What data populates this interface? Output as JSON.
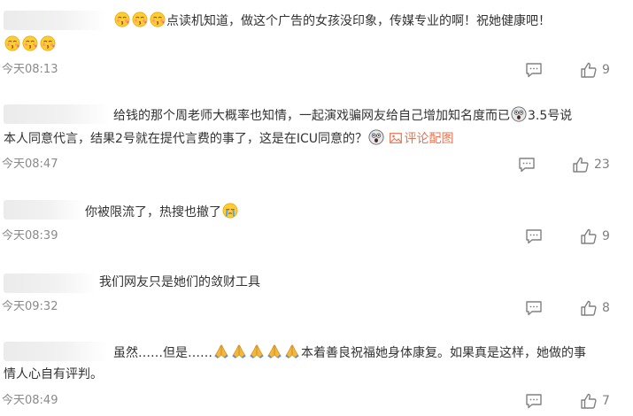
{
  "comments": [
    {
      "line1": "点读机知道，做这个广告的女孩没印象，传媒专业的啊！祝她健康吧！",
      "time": "今天08:13",
      "likes": "9"
    },
    {
      "line1a": "给钱的那个周老师大概率也知情，一起演戏骗网友给自己增加知名度而已",
      "line1b": "3.5号说",
      "line2a": "本人同意代言，结果2号就在提代言费的事了，这是在ICU同意的？",
      "link": "评论配图",
      "time": "今天08:47",
      "likes": "23"
    },
    {
      "line1": "你被限流了，热搜也撤了",
      "time": "今天08:39",
      "likes": "9"
    },
    {
      "line1": "我们网友只是她们的敛财工具",
      "time": "今天09:32",
      "likes": "8"
    },
    {
      "line1a": "虽然……但是……",
      "line1b": "本着善良祝福她身体康复。如果真是这样，她做的事",
      "line2": "情人心自有评判。",
      "time": "今天08:49",
      "likes": "7"
    }
  ],
  "icons": {
    "reply": "comment-icon",
    "like": "thumbs-up-icon",
    "emoji_kiss": "kiss-face-emoji",
    "emoji_shock": "shocked-face-emoji",
    "emoji_cry": "crying-face-emoji",
    "emoji_pray": "praying-hands-emoji",
    "picture": "picture-icon"
  },
  "colors": {
    "link": "#eb7350",
    "time": "#8a8a8a",
    "text": "#333333"
  }
}
